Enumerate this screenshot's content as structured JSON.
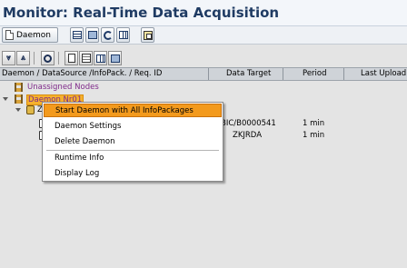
{
  "window": {
    "title": "Monitor: Real-Time Data Acquisition"
  },
  "app_toolbar": {
    "daemon_label": "Daemon"
  },
  "tree_toolbar": {
    "find_icon": "binoculars-icon"
  },
  "columns": [
    "Daemon / DataSource /InfoPack. / Req. ID",
    "Data Target",
    "Period",
    "Last Upload"
  ],
  "tree": {
    "unassigned_nodes": "Unassigned Nodes",
    "daemon_node": "Daemon Nr01",
    "datasource_prefix": "Z",
    "rows": [
      {
        "data_target": "BIC/B0000541",
        "period": "1  min"
      },
      {
        "data_target": "ZKJRDA",
        "period": "1  min"
      }
    ]
  },
  "context_menu": {
    "items": [
      "Start Daemon with All InfoPackages",
      "Daemon Settings",
      "Delete Daemon",
      "Runtime Info",
      "Display Log"
    ]
  },
  "colors": {
    "title": "#1f3b63",
    "highlight": "#f39a1d",
    "unassigned": "#7f2a8a"
  }
}
